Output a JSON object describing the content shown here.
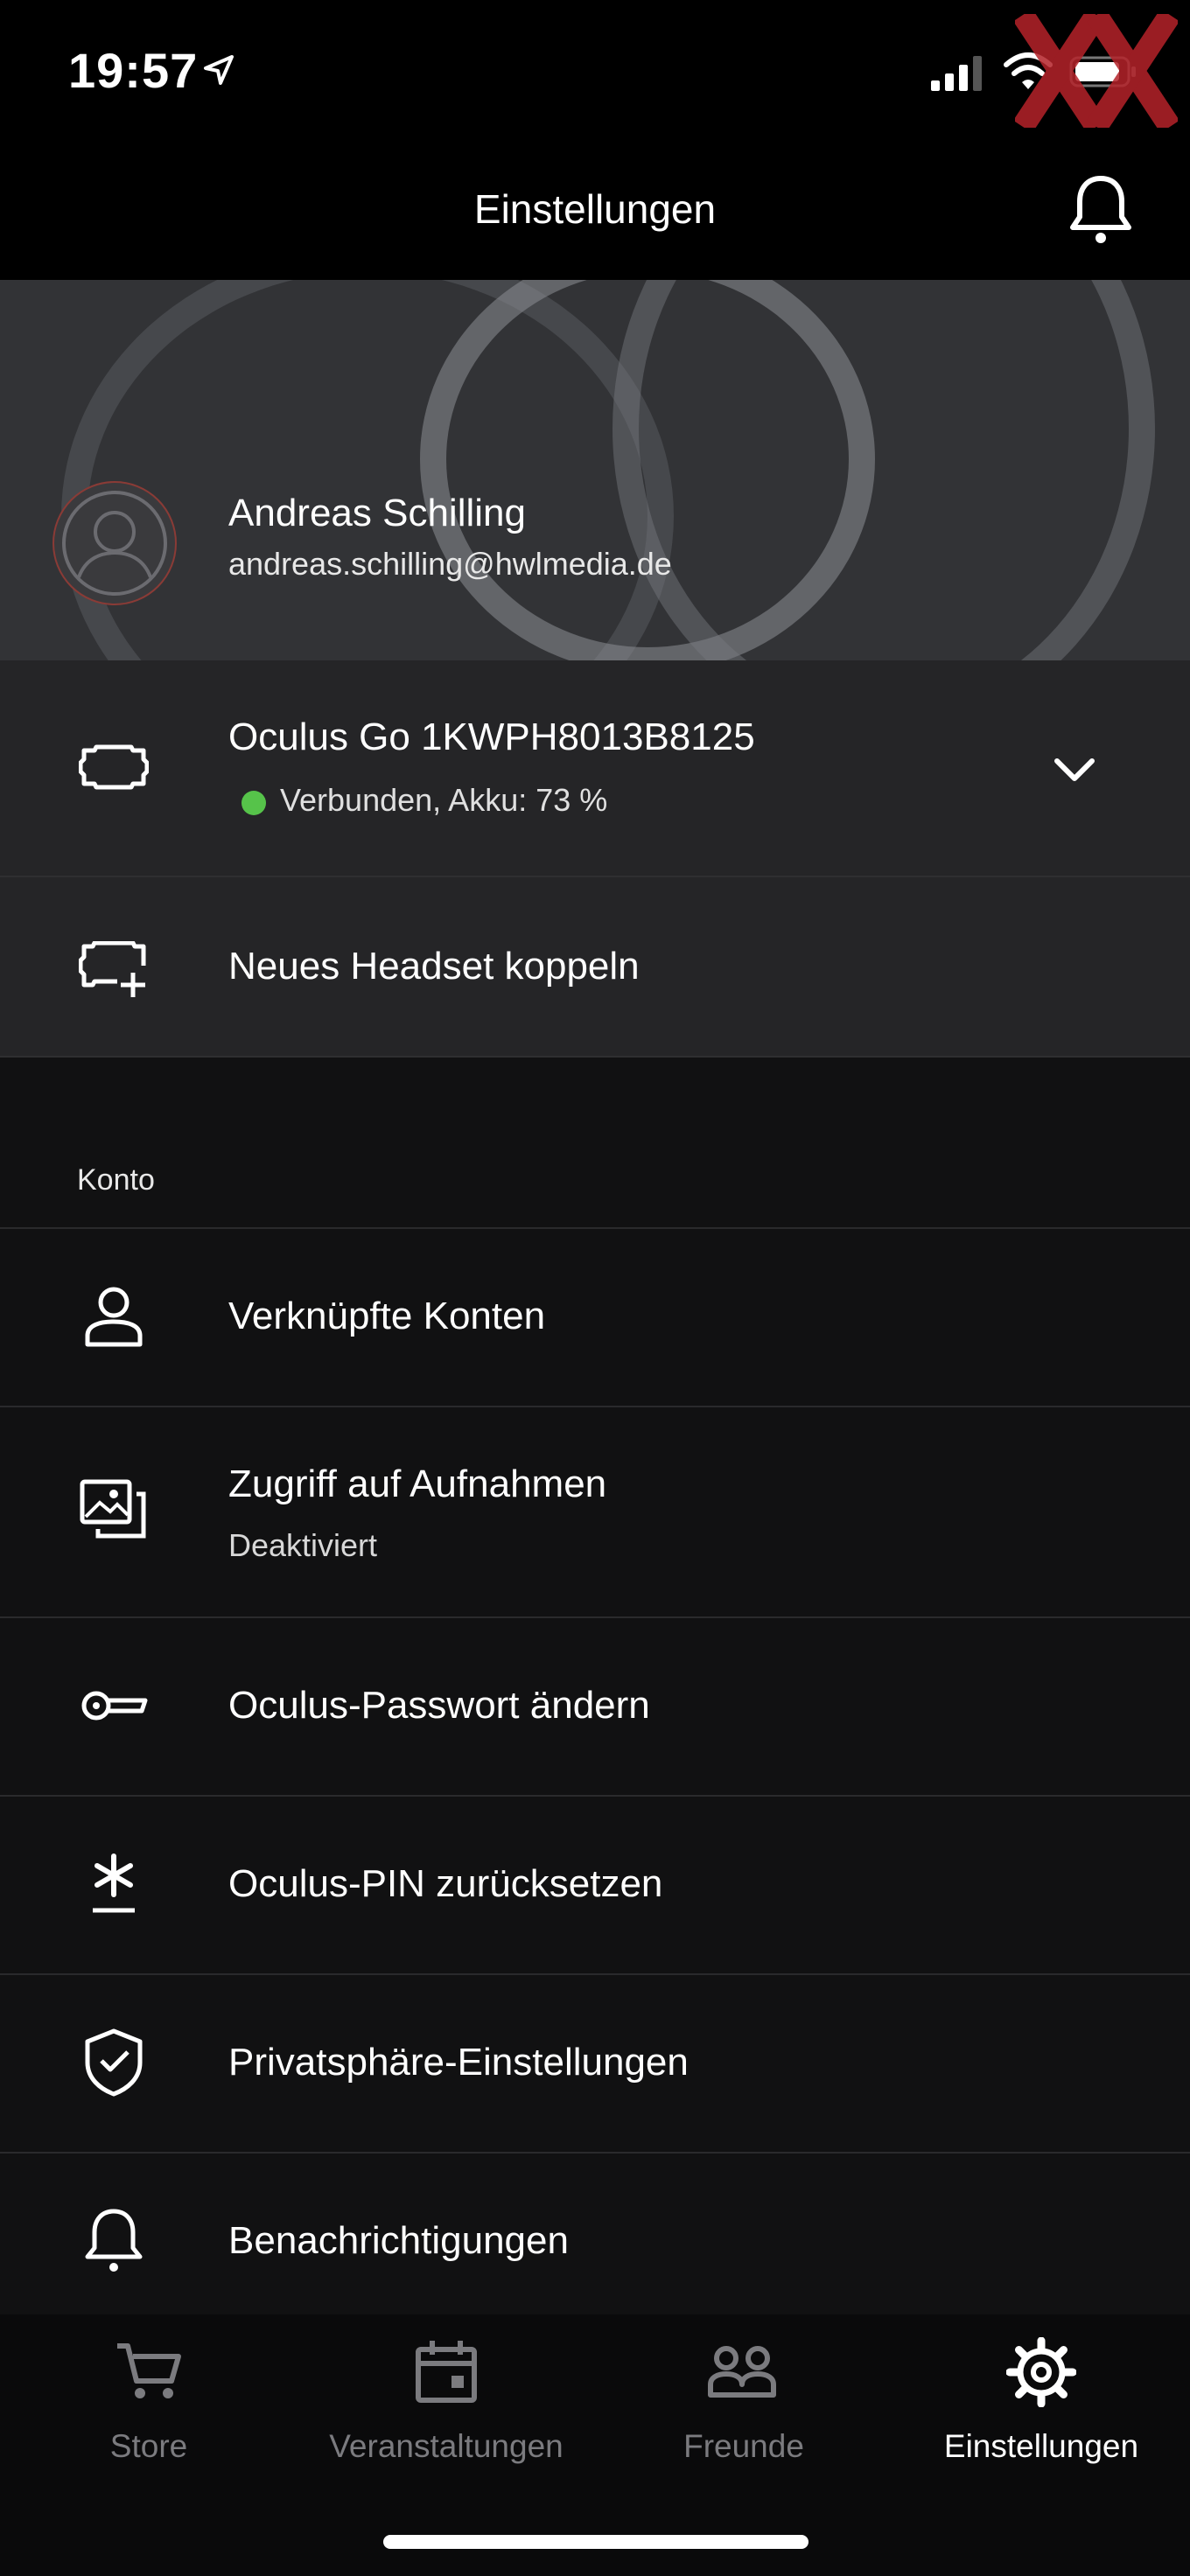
{
  "status_bar": {
    "time": "19:57",
    "icons": [
      "location-arrow-icon",
      "signal-bars-icon",
      "wifi-icon",
      "battery-icon"
    ],
    "watermark_icon": "xx-logo-icon"
  },
  "header": {
    "title": "Einstellungen",
    "bell_icon": "bell-icon"
  },
  "profile": {
    "name": "Andreas Schilling",
    "email": "andreas.schilling@hwlmedia.de",
    "avatar_icon": "person-avatar-icon"
  },
  "device": {
    "name": "Oculus Go 1KWPH8013B8125",
    "status": "Verbunden, Akku: 73 %",
    "status_color": "#56c34a",
    "icon": "headset-icon",
    "expand_icon": "chevron-down-icon"
  },
  "pair": {
    "label": "Neues Headset koppeln",
    "icon": "headset-add-icon"
  },
  "account_section": {
    "title": "Konto",
    "items": [
      {
        "label": "Verknüpfte Konten",
        "icon": "person-icon"
      },
      {
        "label": "Zugriff auf Aufnahmen",
        "sub": "Deaktiviert",
        "icon": "media-gallery-icon"
      },
      {
        "label": "Oculus-Passwort ändern",
        "icon": "key-icon"
      },
      {
        "label": "Oculus-PIN zurücksetzen",
        "icon": "asterisk-pin-icon"
      },
      {
        "label": "Privatsphäre-Einstellungen",
        "icon": "shield-check-icon"
      },
      {
        "label": "Benachrichtigungen",
        "icon": "bell-icon"
      }
    ]
  },
  "tabbar": {
    "tabs": [
      {
        "label": "Store",
        "icon": "cart-icon",
        "active": false
      },
      {
        "label": "Veranstaltungen",
        "icon": "calendar-icon",
        "active": false
      },
      {
        "label": "Freunde",
        "icon": "friends-icon",
        "active": false
      },
      {
        "label": "Einstellungen",
        "icon": "gear-icon",
        "active": true
      }
    ],
    "active_color": "#ffffff",
    "inactive_color": "#7b7b7f"
  }
}
